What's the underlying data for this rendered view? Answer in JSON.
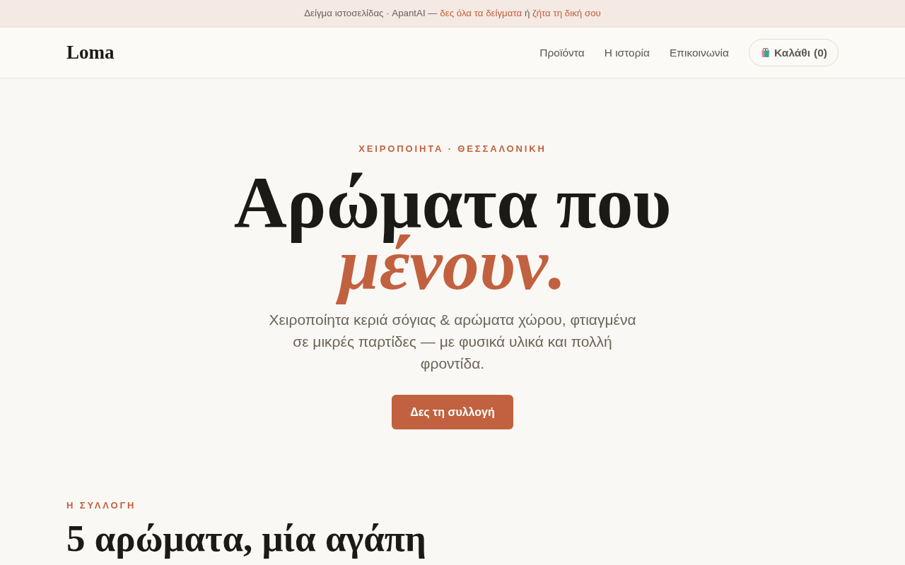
{
  "banner": {
    "prefix": "Δείγμα ιστοσελίδας · ApantAI —",
    "links": [
      {
        "label": "δες όλα τα δείγματα"
      },
      {
        "label": "ζήτα τη δική σου"
      }
    ],
    "joiner": "ή"
  },
  "header": {
    "logo": "Loma",
    "nav": [
      {
        "label": "Προϊόντα"
      },
      {
        "label": "Η ιστορία"
      },
      {
        "label": "Επικοινωνία"
      }
    ],
    "cart": {
      "label": "Καλάθι",
      "count": "(0)"
    }
  },
  "hero": {
    "eyebrow": "ΧΕΙΡΟΠΟΙΗΤΑ · ΘΕΣΣΑΛΟΝΙΚΗ",
    "title": "Αρώματα που",
    "title_accent": "μένουν.",
    "description": "Χειροποίητα κεριά σόγιας & αρώματα χώρου, φτιαγμένα σε μικρές παρτίδες — με φυσικά υλικά και πολλή φροντίδα.",
    "button": "Δες τη συλλογή"
  },
  "collection": {
    "eyebrow": "Η ΣΥΛΛΟΓΗ",
    "title": "5 αρώματα, μία αγάπη"
  }
}
